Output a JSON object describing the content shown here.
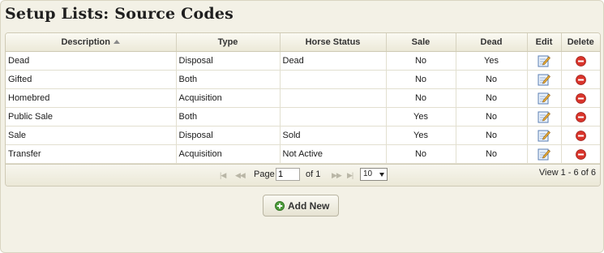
{
  "page_title": "Setup Lists: Source Codes",
  "table": {
    "columns": [
      "Description",
      "Type",
      "Horse Status",
      "Sale",
      "Dead",
      "Edit",
      "Delete"
    ],
    "sort_column": "Description",
    "rows": [
      {
        "description": "Dead",
        "type": "Disposal",
        "horse_status": "Dead",
        "sale": "No",
        "dead": "Yes"
      },
      {
        "description": "Gifted",
        "type": "Both",
        "horse_status": "",
        "sale": "No",
        "dead": "No"
      },
      {
        "description": "Homebred",
        "type": "Acquisition",
        "horse_status": "",
        "sale": "No",
        "dead": "No"
      },
      {
        "description": "Public Sale",
        "type": "Both",
        "horse_status": "",
        "sale": "Yes",
        "dead": "No"
      },
      {
        "description": "Sale",
        "type": "Disposal",
        "horse_status": "Sold",
        "sale": "Yes",
        "dead": "No"
      },
      {
        "description": "Transfer",
        "type": "Acquisition",
        "horse_status": "Not Active",
        "sale": "No",
        "dead": "No"
      }
    ]
  },
  "pager": {
    "page_label": "Page",
    "page_value": "1",
    "of_label": "of 1",
    "page_size": "10",
    "view_text": "View 1 - 6 of 6"
  },
  "add_button": {
    "label": "Add New"
  },
  "icons": {
    "sort": "sort-ascending-icon",
    "edit": "edit-pencil-icon",
    "delete": "delete-minus-icon",
    "first": "first-page-icon",
    "prev": "prev-page-icon",
    "next": "next-page-icon",
    "last": "last-page-icon",
    "add": "add-plus-icon"
  },
  "colors": {
    "panel_bg": "#f3f1e6",
    "delete_red": "#d9342b",
    "add_green": "#4c9b3a"
  }
}
